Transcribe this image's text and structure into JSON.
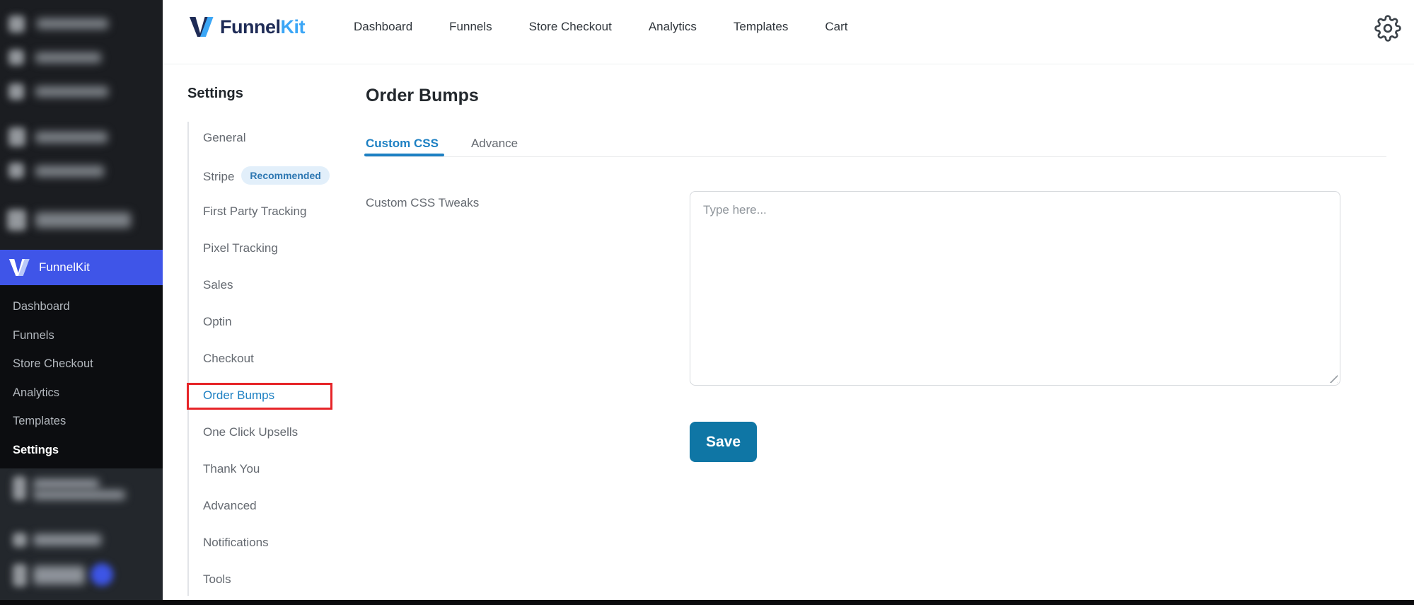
{
  "header": {
    "logo": {
      "brand_dark": "Funnel",
      "brand_light": "Kit"
    },
    "nav": [
      "Dashboard",
      "Funnels",
      "Store Checkout",
      "Analytics",
      "Templates",
      "Cart"
    ],
    "gear_icon": "settings-gear"
  },
  "wp_sidebar": {
    "funnelkit_label": "FunnelKit",
    "submenu": [
      "Dashboard",
      "Funnels",
      "Store Checkout",
      "Analytics",
      "Templates",
      "Settings"
    ],
    "active_item": "Settings",
    "accent_color": "#3f55e8"
  },
  "settings_nav": {
    "heading": "Settings",
    "items": [
      {
        "label": "General"
      },
      {
        "label": "Stripe",
        "badge": "Recommended"
      },
      {
        "label": "First Party Tracking"
      },
      {
        "label": "Pixel Tracking"
      },
      {
        "label": "Sales"
      },
      {
        "label": "Optin"
      },
      {
        "label": "Checkout"
      },
      {
        "label": "Order Bumps",
        "active": true,
        "annotated": true
      },
      {
        "label": "One Click Upsells"
      },
      {
        "label": "Thank You"
      },
      {
        "label": "Advanced"
      },
      {
        "label": "Notifications"
      },
      {
        "label": "Tools"
      }
    ],
    "active_color": "#1d80c3",
    "annotation_color": "#e62428"
  },
  "main": {
    "title": "Order Bumps",
    "tabs": [
      {
        "label": "Custom CSS",
        "active": true
      },
      {
        "label": "Advance",
        "active": false
      }
    ],
    "custom_css": {
      "label": "Custom CSS Tweaks",
      "placeholder": "Type here...",
      "value": ""
    },
    "save_label": "Save",
    "save_color": "#0f76a5"
  }
}
